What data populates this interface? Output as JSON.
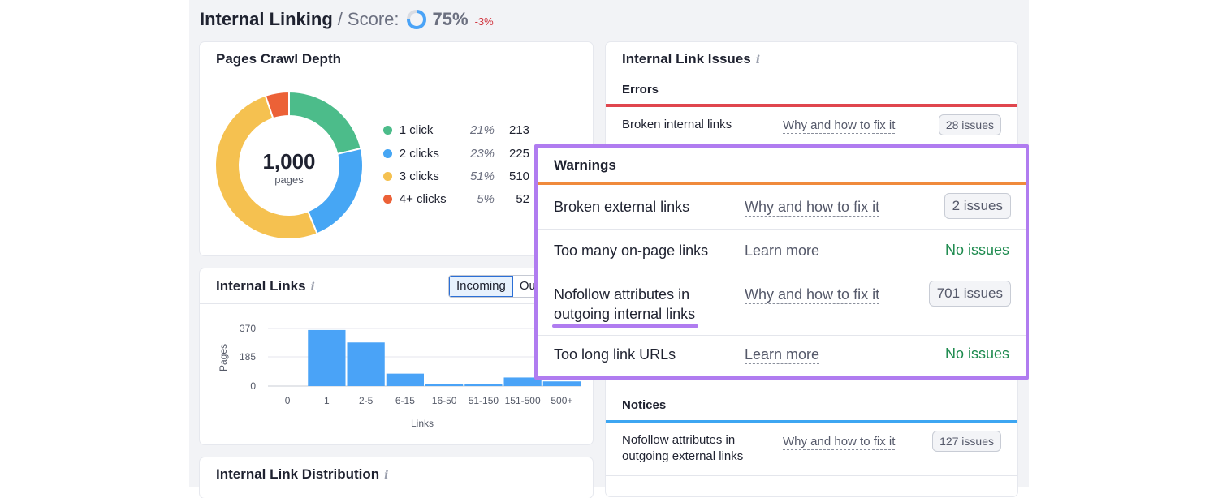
{
  "header": {
    "title": "Internal Linking",
    "slash": "/",
    "score_label": "Score:",
    "score_value": "75%",
    "score_delta": "-3%",
    "score_fraction": 0.75,
    "accent": "#4aa3f7"
  },
  "crawl_depth": {
    "title": "Pages Crawl Depth",
    "total": "1,000",
    "total_label": "pages",
    "items": [
      {
        "label": "1 click",
        "pct": "21%",
        "count": "213",
        "color": "#4cbc8a"
      },
      {
        "label": "2 clicks",
        "pct": "23%",
        "count": "225",
        "color": "#46a6f4"
      },
      {
        "label": "3 clicks",
        "pct": "51%",
        "count": "510",
        "color": "#f5c150"
      },
      {
        "label": "4+ clicks",
        "pct": "5%",
        "count": "52",
        "color": "#ec6137"
      }
    ]
  },
  "internal_links": {
    "title": "Internal Links",
    "info_icon": "i",
    "toggle_active": "Incoming",
    "toggle_inactive": "Ou",
    "y_ticks": [
      "370",
      "185",
      "0"
    ],
    "ylabel": "Pages",
    "xlabel": "Links"
  },
  "chart_data": {
    "type": "bar",
    "categories": [
      "0",
      "1",
      "2-5",
      "6-15",
      "16-50",
      "51-150",
      "151-500",
      "500+"
    ],
    "values": [
      0,
      360,
      280,
      80,
      12,
      15,
      55,
      30
    ],
    "ylabel": "Pages",
    "xlabel": "Links",
    "ylim": [
      0,
      370
    ],
    "y_ticks": [
      0,
      185,
      370
    ],
    "grid": true,
    "color": "#4aa3f7"
  },
  "distribution": {
    "title": "Internal Link Distribution",
    "info_icon": "i"
  },
  "issues": {
    "title": "Internal Link Issues",
    "info_icon": "i",
    "errors": {
      "label": "Errors",
      "color": "#e0464e",
      "rows": [
        {
          "text": "Broken internal links",
          "link": "Why and how to fix it",
          "badge": "28 issues"
        }
      ]
    },
    "notices": {
      "label": "Notices",
      "color": "#3da6f2",
      "rows": [
        {
          "text_line1": "Nofollow attributes in",
          "text_line2": "outgoing external links",
          "link": "Why and how to fix it",
          "badge": "127 issues"
        }
      ]
    }
  },
  "warnings": {
    "label": "Warnings",
    "color": "#f08a3c",
    "highlight_color": "#b07cf0",
    "rows": [
      {
        "text": "Broken external links",
        "link": "Why and how to fix it",
        "badge": "2 issues"
      },
      {
        "text": "Too many on-page links",
        "link": "Learn more",
        "status": "No issues"
      },
      {
        "text_line1": "Nofollow attributes in",
        "text_line2": "outgoing internal links",
        "link": "Why and how to fix it",
        "badge": "701 issues"
      },
      {
        "text": "Too long link URLs",
        "link": "Learn more",
        "status": "No issues"
      }
    ]
  }
}
